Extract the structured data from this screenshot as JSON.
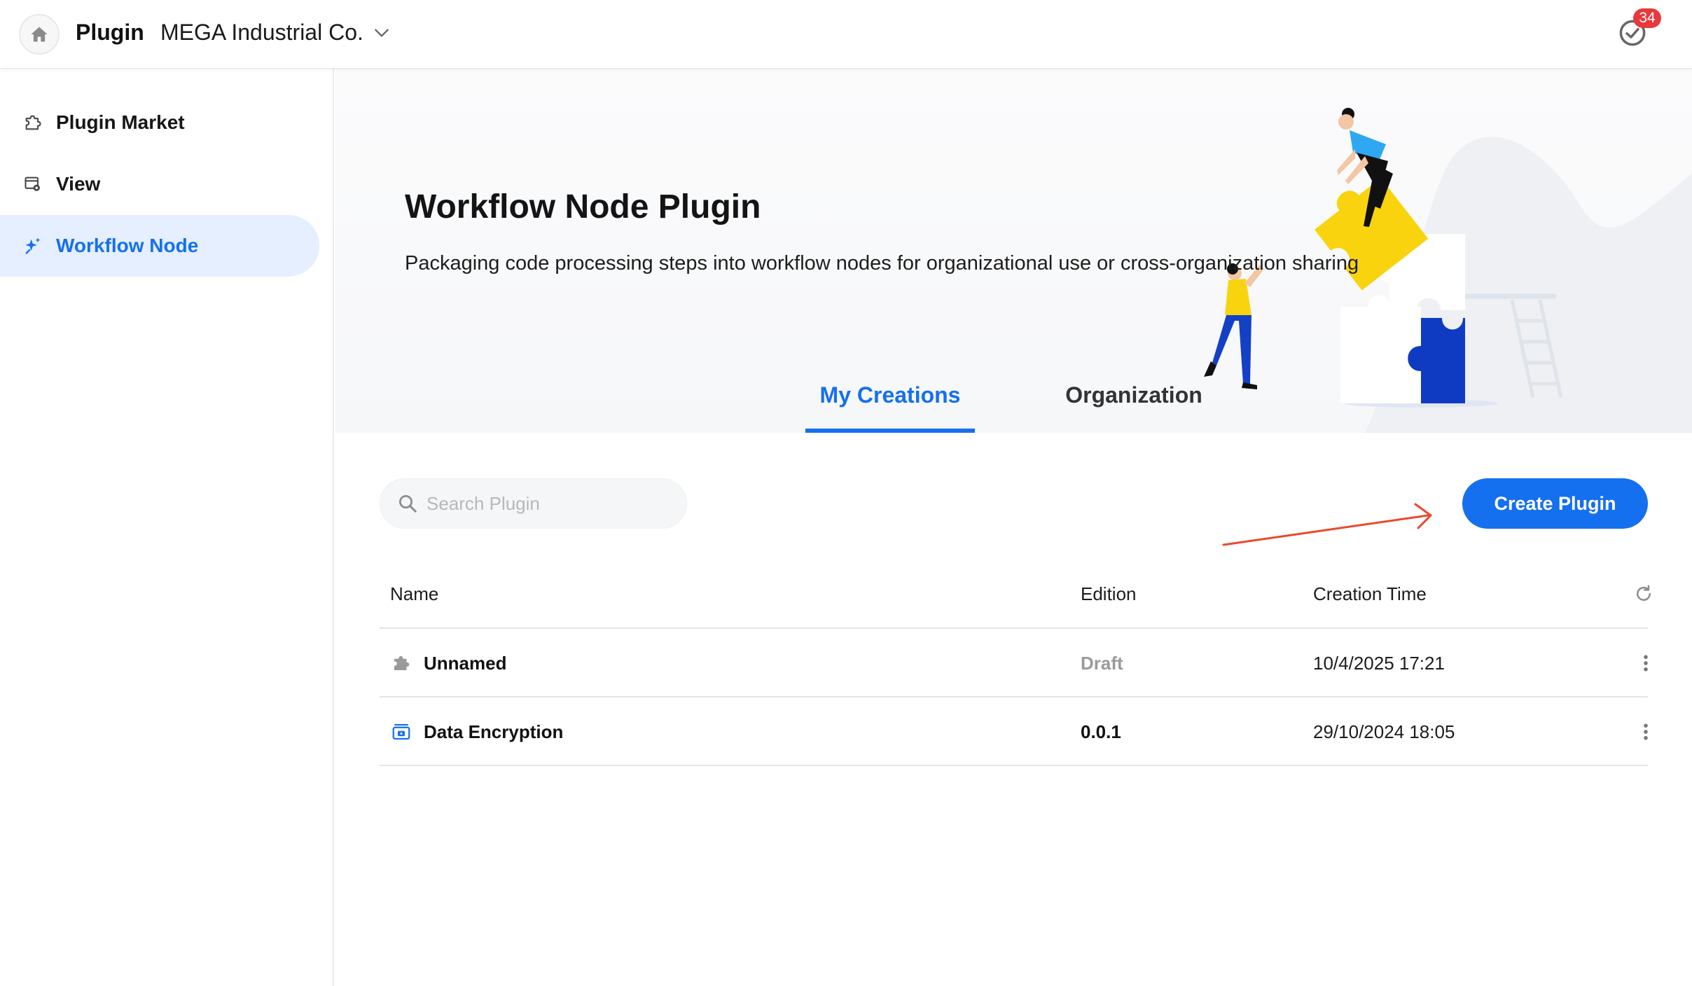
{
  "topbar": {
    "app_title": "Plugin",
    "org_name": "MEGA Industrial Co.",
    "notification_count": "34"
  },
  "sidebar": {
    "items": [
      {
        "label": "Plugin Market",
        "icon": "puzzle-outline-icon",
        "active": false
      },
      {
        "label": "View",
        "icon": "window-view-icon",
        "active": false
      },
      {
        "label": "Workflow Node",
        "icon": "sparkle-icon",
        "active": true
      }
    ]
  },
  "hero": {
    "title": "Workflow Node Plugin",
    "description": "Packaging code processing steps into workflow nodes for organizational use or cross-organization sharing"
  },
  "tabs": [
    {
      "label": "My Creations",
      "active": true
    },
    {
      "label": "Organization",
      "active": false
    }
  ],
  "search": {
    "placeholder": "Search Plugin",
    "value": ""
  },
  "create_button": {
    "label": "Create Plugin"
  },
  "table": {
    "headers": {
      "name": "Name",
      "edition": "Edition",
      "time": "Creation Time"
    },
    "rows": [
      {
        "name": "Unnamed",
        "icon": "puzzle-gray-icon",
        "edition": "Draft",
        "time": "10/4/2025 17:21"
      },
      {
        "name": "Data Encryption",
        "icon": "encryption-blue-icon",
        "edition": "0.0.1",
        "time": "29/10/2024 18:05"
      }
    ]
  },
  "colors": {
    "accent": "#1570ef",
    "badge": "#e8383d",
    "active_bg": "#e5efff",
    "annotation_arrow": "#e8492b"
  }
}
